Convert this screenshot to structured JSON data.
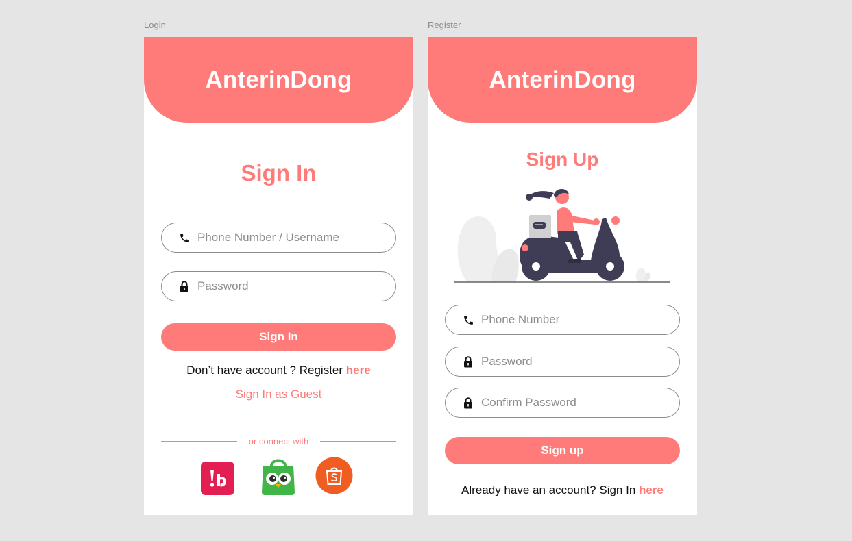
{
  "colors": {
    "accent": "#ff7b79",
    "background": "#e5e5e5",
    "panel": "#ffffff"
  },
  "login": {
    "frame_label": "Login",
    "brand": "AnterinDong",
    "title": "Sign In",
    "phone_placeholder": "Phone Number / Username",
    "password_placeholder": "Password",
    "signin_button": "Sign In",
    "register_prompt": "Don’t have account ? Register",
    "register_link": "here",
    "guest_link": "Sign In as Guest",
    "connect_text": "or connect with",
    "social": [
      {
        "icon": "bukalapak-icon"
      },
      {
        "icon": "tokopedia-icon"
      },
      {
        "icon": "shopee-icon"
      }
    ]
  },
  "register": {
    "frame_label": "Register",
    "brand": "AnterinDong",
    "title": "Sign Up",
    "phone_placeholder": "Phone Number",
    "password_placeholder": "Password",
    "confirm_placeholder": "Confirm Password",
    "signup_button": "Sign up",
    "signin_prompt": "Already have an account? Sign In",
    "signin_link": "here"
  }
}
